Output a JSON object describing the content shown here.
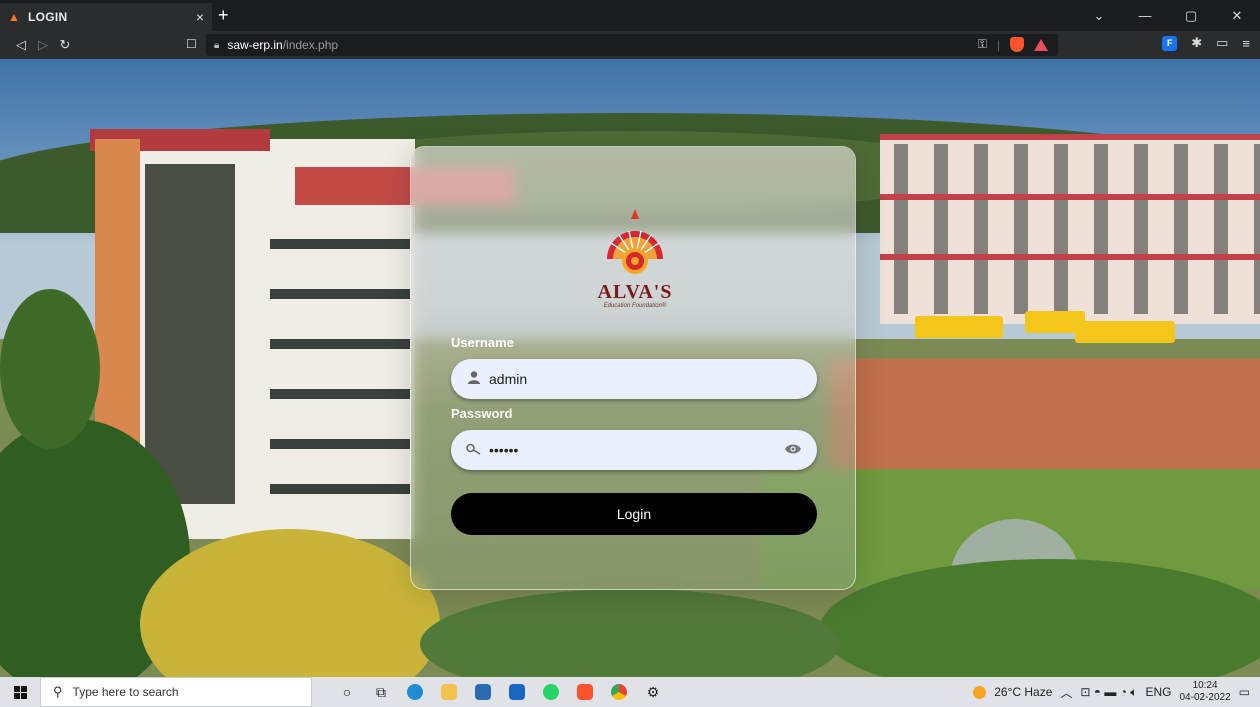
{
  "browser": {
    "tab_title": "LOGIN",
    "tab_close": "×",
    "new_tab": "+",
    "url_host": "saw-erp.in",
    "url_path": "/index.php",
    "win_min": "—",
    "win_max": "▢",
    "win_close": "✕",
    "win_menu": "⌄"
  },
  "login": {
    "logo_text": "ALVA'S",
    "logo_sub": "Education Foundation®",
    "username_label": "Username",
    "username_value": "admin",
    "password_label": "Password",
    "password_value": "••••••",
    "login_button": "Login"
  },
  "taskbar": {
    "search_placeholder": "Type here to search",
    "weather": "26°C  Haze",
    "lang": "ENG",
    "time": "10:24",
    "date": "04-02-2022"
  },
  "colors": {
    "tab_bg": "#2b2c30",
    "login_button": "#000000",
    "input_bg": "#eaf0fe",
    "brave_orange": "#fb542b"
  },
  "icons": [
    "lock-icon",
    "bookmark-icon",
    "key-icon",
    "brave-shield-icon",
    "brave-rewards-icon",
    "user-icon",
    "key-search-icon",
    "eye-icon",
    "windows-icon",
    "search-icon"
  ]
}
